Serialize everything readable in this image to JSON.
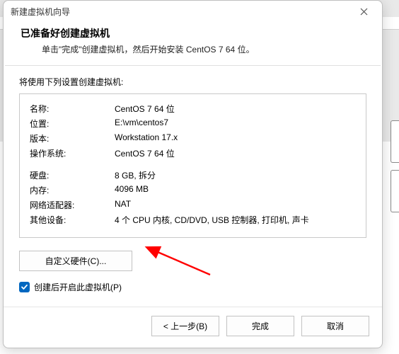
{
  "window": {
    "title": "新建虚拟机向导"
  },
  "header": {
    "heading": "已准备好创建虚拟机",
    "subtext": "单击\"完成\"创建虚拟机，然后开始安装 CentOS 7 64 位。"
  },
  "body": {
    "prompt": "将使用下列设置创建虚拟机:",
    "rows1": [
      {
        "k": "名称:",
        "v": "CentOS 7 64 位"
      },
      {
        "k": "位置:",
        "v": "E:\\vm\\centos7"
      },
      {
        "k": "版本:",
        "v": "Workstation 17.x"
      },
      {
        "k": "操作系统:",
        "v": "CentOS 7 64 位"
      }
    ],
    "rows2": [
      {
        "k": "硬盘:",
        "v": "8 GB, 拆分"
      },
      {
        "k": "内存:",
        "v": "4096 MB"
      },
      {
        "k": "网络适配器:",
        "v": "NAT"
      },
      {
        "k": "其他设备:",
        "v": "4 个 CPU 内核, CD/DVD, USB 控制器, 打印机, 声卡"
      }
    ],
    "customize_label": "自定义硬件(C)...",
    "poweron_label": "创建后开启此虚拟机(P)",
    "poweron_checked": true
  },
  "footer": {
    "back": "< 上一步(B)",
    "finish": "完成",
    "cancel": "取消"
  }
}
